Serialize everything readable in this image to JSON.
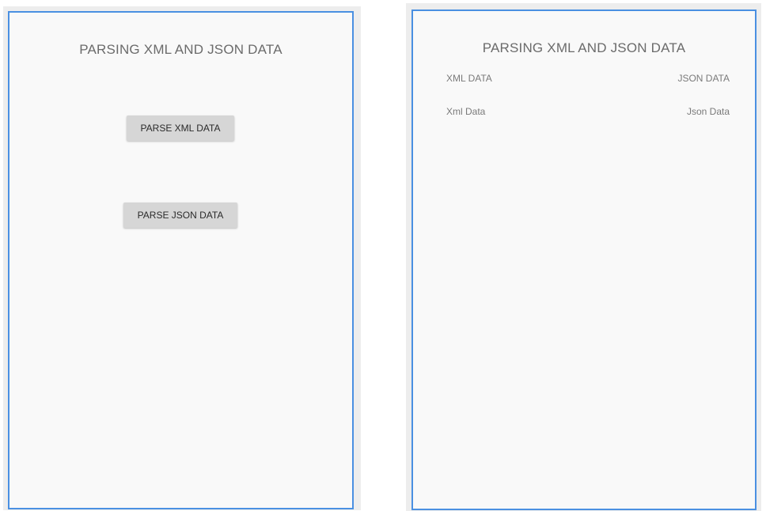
{
  "left_screen": {
    "title": "PARSING XML AND JSON DATA",
    "parse_xml_button": "PARSE XML DATA",
    "parse_json_button": "PARSE JSON DATA"
  },
  "right_screen": {
    "title": "PARSING XML AND JSON DATA",
    "xml_header": "XML DATA",
    "json_header": "JSON DATA",
    "xml_value": "Xml Data",
    "json_value": "Json Data"
  },
  "colors": {
    "frame_border": "#4a90e2",
    "screen_background": "#f9f9f9",
    "button_background": "#d6d6d6"
  }
}
